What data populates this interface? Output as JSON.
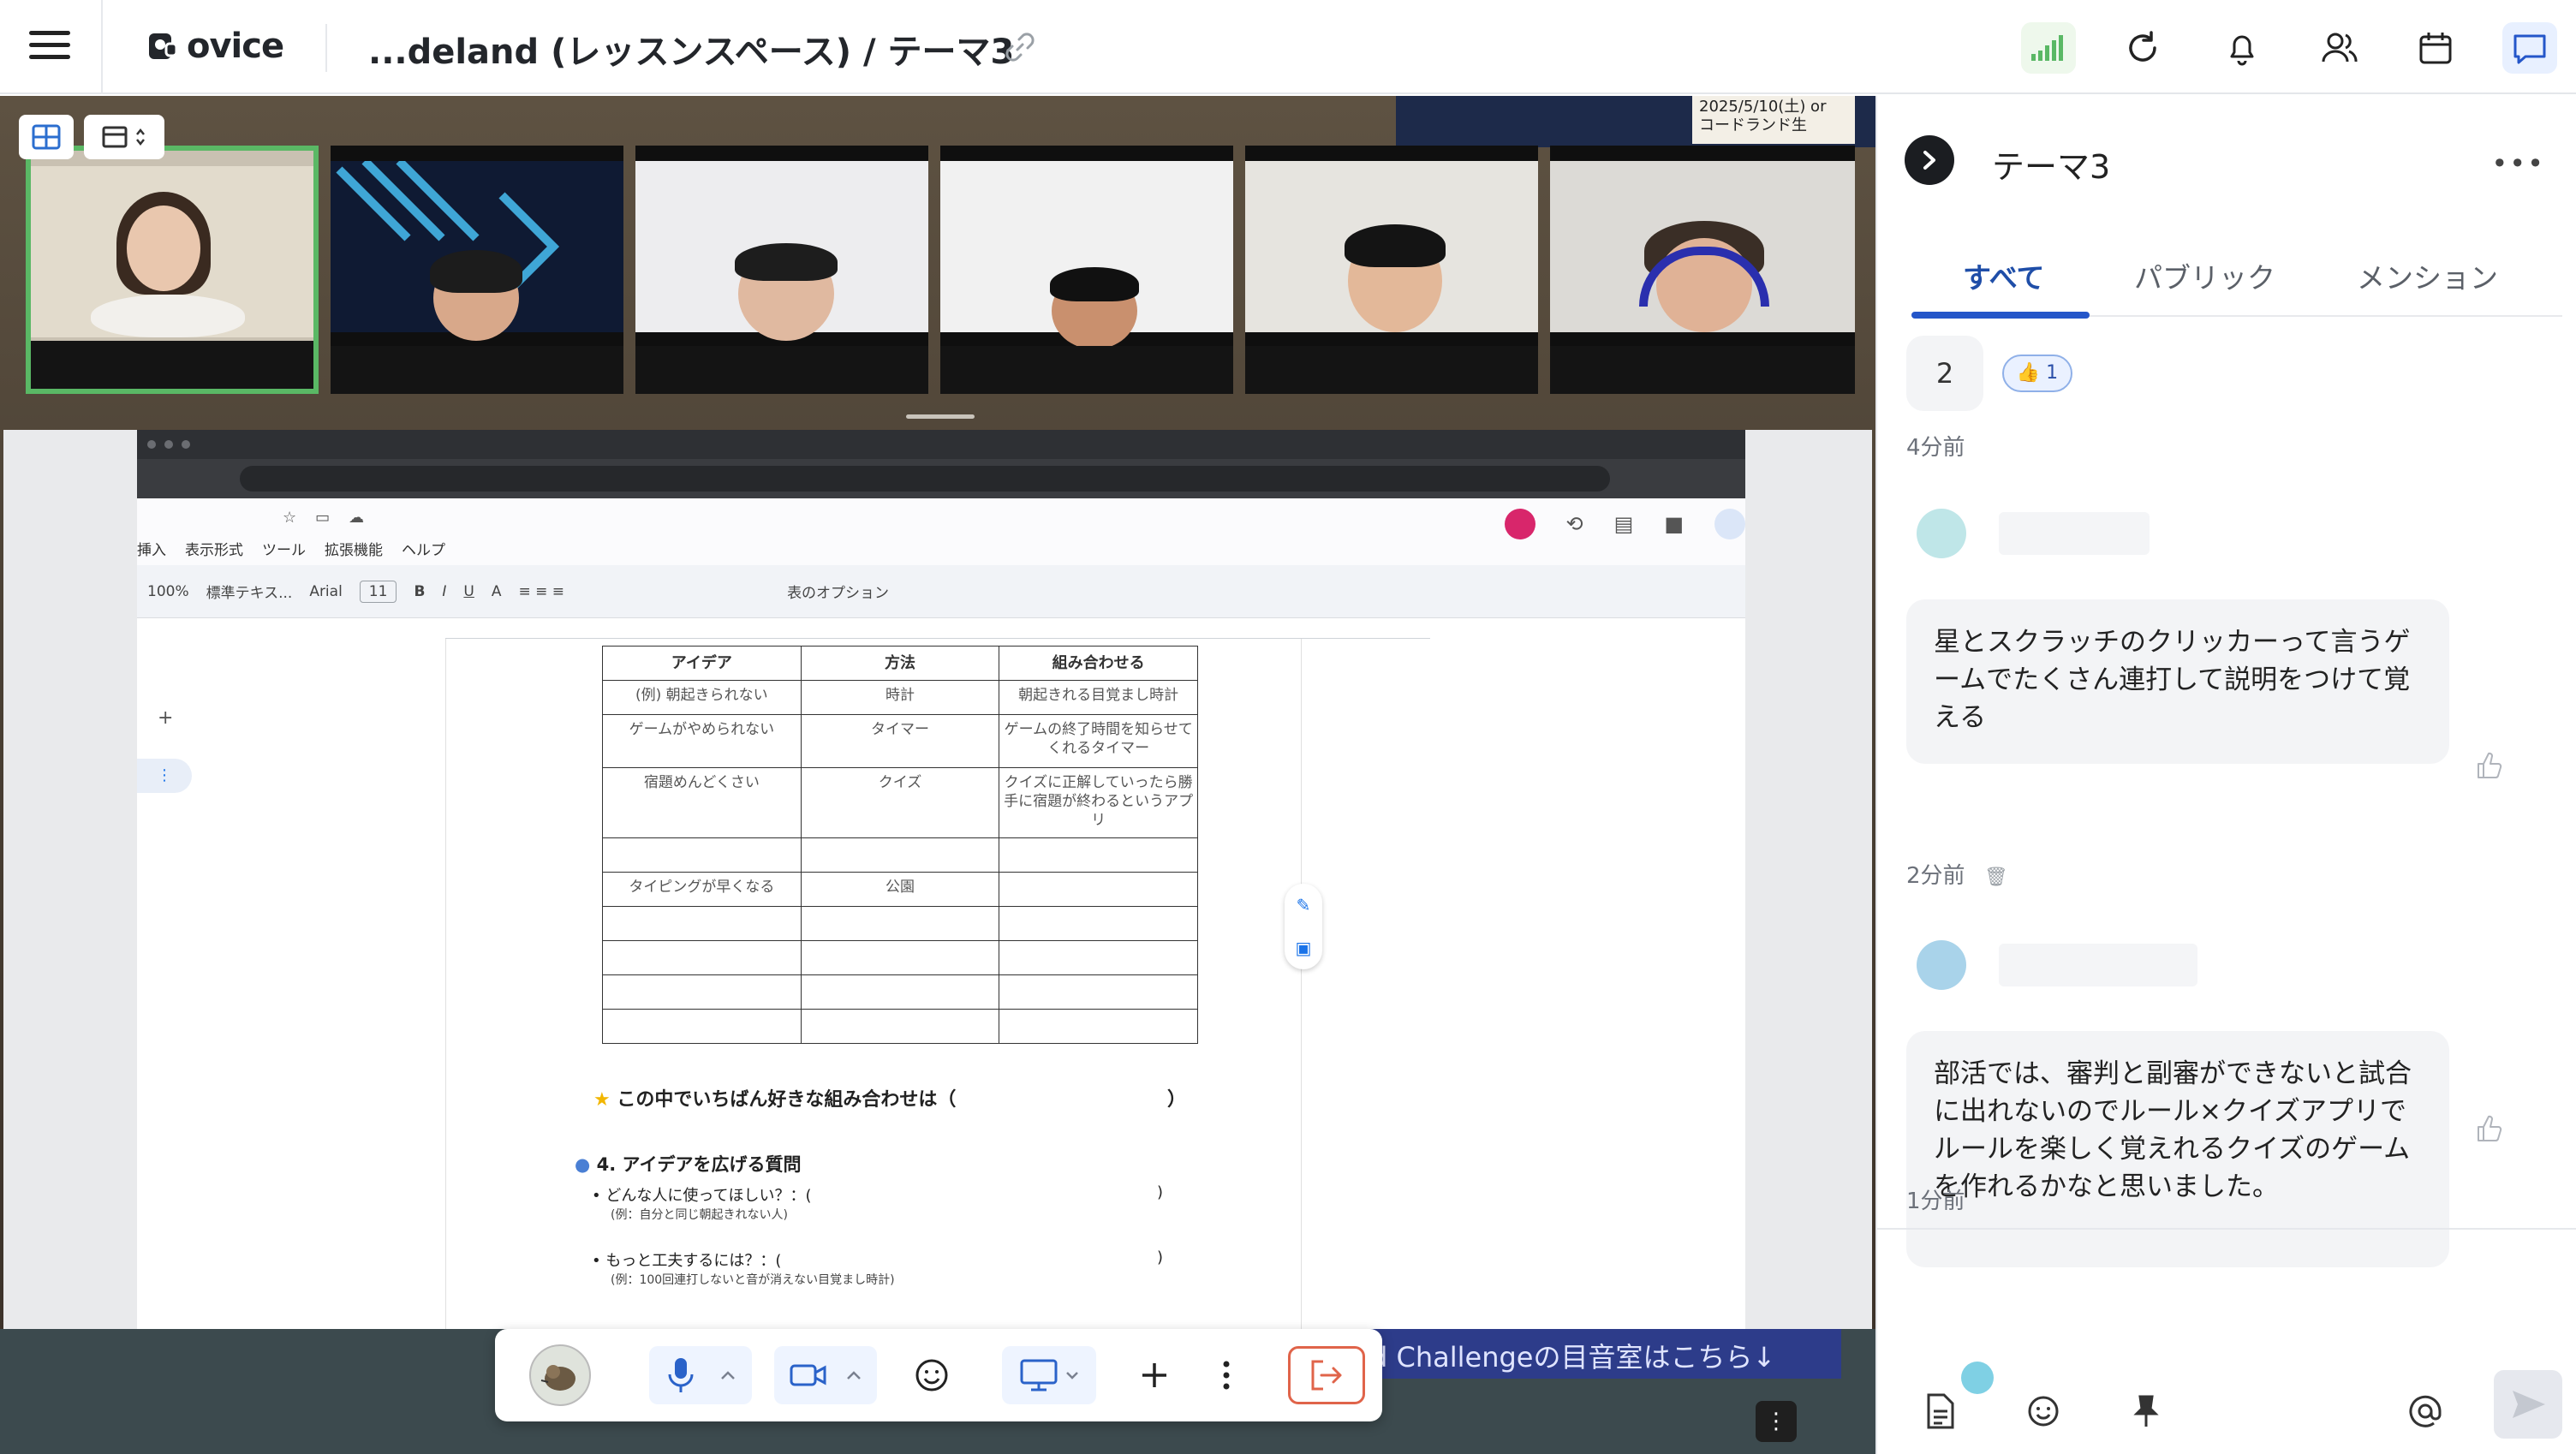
{
  "app": {
    "brand": "ovice",
    "space_title": "...deland (レッスンスペース) / テーマ3"
  },
  "stage": {
    "banner_date": "2025/5/10(土) or",
    "banner_sub": "コードランド生",
    "bottom_ribbon": "d Challengeの目音室はこちら↓"
  },
  "document": {
    "menus": [
      "挿入",
      "表示形式",
      "ツール",
      "拡張機能",
      "ヘルプ"
    ],
    "zoom": "100%",
    "style": "標準テキス...",
    "font": "Arial",
    "font_size": "11",
    "table_options": "表のオプション",
    "table": {
      "headers": [
        "アイデア",
        "方法",
        "組み合わせる"
      ],
      "rows": [
        [
          "(例) 朝起きられない",
          "時計",
          "朝起きれる目覚まし時計"
        ],
        [
          "ゲームがやめられない",
          "タイマー",
          "ゲームの終了時間を知らせてくれるタイマー"
        ],
        [
          "宿題めんどくさい",
          "クイズ",
          "クイズに正解していったら勝手に宿題が終わるというアプリ"
        ],
        [
          "",
          "",
          ""
        ],
        [
          "タイピングが早くなる",
          "公園",
          ""
        ],
        [
          "",
          "",
          ""
        ],
        [
          "",
          "",
          ""
        ],
        [
          "",
          "",
          ""
        ],
        [
          "",
          "",
          ""
        ]
      ]
    },
    "question_star": "この中でいちばん好きな組み合わせは（",
    "question_close": "）",
    "section4": "4. アイデアを広げる質問",
    "bullet1": "どんな人に使ってほしい？：(",
    "bullet1_example": "(例：自分と同じ朝起きれない人)",
    "bullet2": "もっと工夫するには？：(",
    "bullet2_example": "(例：100回連打しないと音が消えない目覚まし時計)",
    "bullet_close": ")"
  },
  "panel": {
    "title": "テーマ3",
    "more": "•••",
    "tabs": [
      "すべて",
      "パブリック",
      "メンション"
    ],
    "messages": [
      {
        "count": "2",
        "reaction": "👍 1",
        "time": "4分前"
      },
      {
        "text": "星とスクラッチのクリッカーって言うゲームでたくさん連打して説明をつけて覚える",
        "time": "2分前"
      },
      {
        "text": "部活では、審判と副審ができないと試合に出れないのでルール×クイズアプリで\nルールを楽しく覚えれるクイズのゲームを作れるかなと思いました。",
        "time": "1分前"
      }
    ]
  },
  "colors": {
    "accent": "#2456c9",
    "active_tile": "#5ab865",
    "leave": "#e0644a",
    "record": "#d8266b"
  }
}
